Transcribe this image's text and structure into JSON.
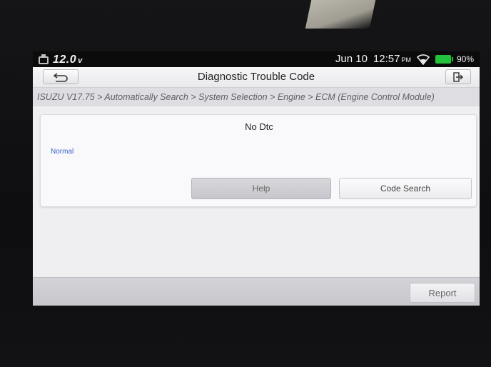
{
  "status_bar": {
    "voltage": "12.0",
    "voltage_unit": "v",
    "date": "Jun 10",
    "time": "12:57",
    "ampm": "PM",
    "battery_percent": "90%"
  },
  "header": {
    "title": "Diagnostic Trouble Code"
  },
  "breadcrumb": {
    "path": "ISUZU V17.75 > Automatically Search > System Selection > Engine > ECM (Engine Control Module)"
  },
  "result": {
    "title": "No Dtc",
    "status": "Normal"
  },
  "actions": {
    "help_label": "Help",
    "code_search_label": "Code Search"
  },
  "footer": {
    "report_label": "Report"
  },
  "colors": {
    "status_text": "#3a62c9",
    "battery": "#22c23a"
  }
}
